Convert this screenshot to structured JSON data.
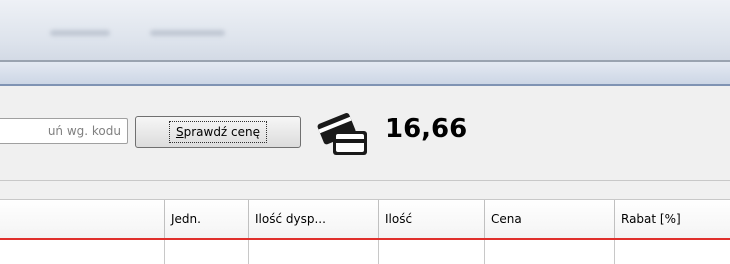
{
  "toolbar": {
    "code_input_value": "uń wg. kodu",
    "check_price_mnemonic": "S",
    "check_price_rest": "prawdź cenę",
    "price": "16,66",
    "icon": "card-payment-icon"
  },
  "grid": {
    "columns": [
      "",
      "Jedn.",
      "Ilość dysp...",
      "Ilość",
      "Cena",
      "Rabat [%]"
    ],
    "accent_line_color": "#e0302c"
  }
}
